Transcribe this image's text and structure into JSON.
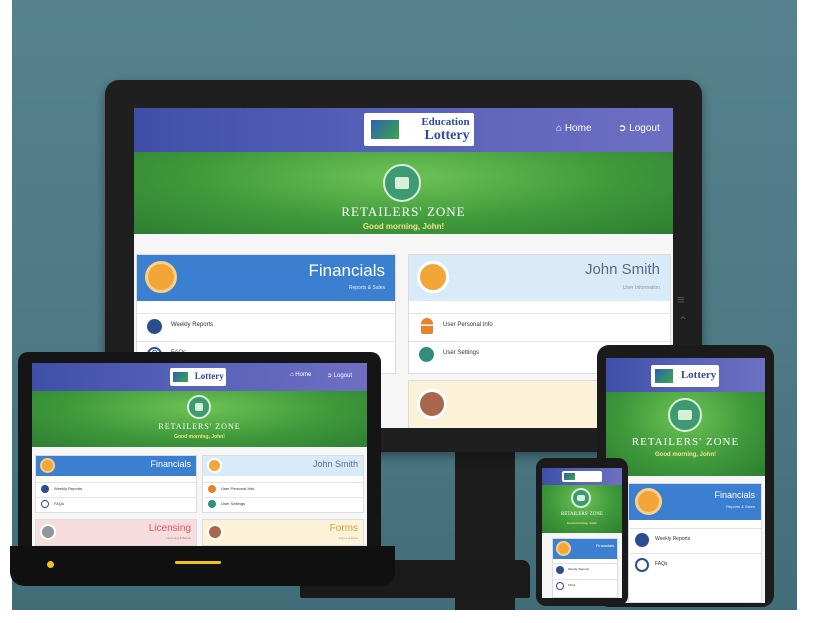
{
  "app": {
    "logo_text_1": "Education",
    "logo_text_2": "Lottery",
    "nav_home": "Home",
    "nav_logout": "Logout",
    "zone_title": "RETAILERS' ZONE",
    "greeting": "Good morning, John!"
  },
  "cards": {
    "financials": {
      "title": "Financials",
      "subtitle": "Reports & Sales"
    },
    "user": {
      "title": "John Smith",
      "subtitle": "User Information"
    },
    "licensing": {
      "title": "Licensing",
      "subtitle": "Licensing & Bonds"
    },
    "forms": {
      "title": "Forms",
      "subtitle": "Forms & Docs"
    }
  },
  "links": {
    "weekly_reports": "Weekly Reports",
    "faqs": "FAQs",
    "user_personal_info": "User Personal Info",
    "user_settings": "User Settings"
  },
  "colors": {
    "nav": "#3f4fa8",
    "hero": "#3f9a3b",
    "financials": "#3b7fd0",
    "user": "#d9ebf8",
    "licensing": "#f6dcdc",
    "forms": "#fbf2d8",
    "icon_orange": "#f2a637",
    "icon_blue": "#2c4d8f",
    "icon_teal": "#2f8f7a",
    "device_bezel": "#1f1f1f",
    "background": "#4f7c87"
  }
}
